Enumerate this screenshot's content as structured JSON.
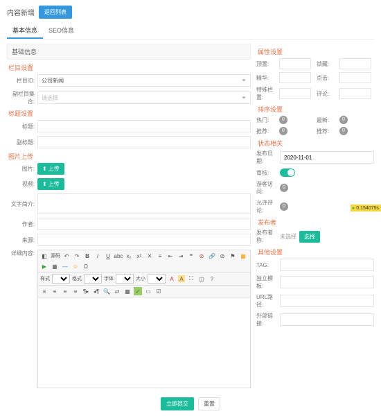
{
  "header": {
    "title": "内容新增",
    "back_btn": "返回列表"
  },
  "tabs": [
    "基本信息",
    "SEO信息"
  ],
  "panel_left": "基础信息",
  "sections": {
    "col": "栏目设置",
    "title": "标题设置",
    "img": "图片上传",
    "prop": "属性设置",
    "sort": "排序设置",
    "status": "状态相关",
    "author": "发布者",
    "other": "其他设置"
  },
  "left": {
    "col_id": "栏目ID:",
    "col_val": "公司新闻",
    "sub_col": "副栏目集合:",
    "sub_ph": "请选择",
    "title_lbl": "标题:",
    "subtitle_lbl": "副标题:",
    "img_lbl": "图片:",
    "vid_lbl": "视频:",
    "upload": "上传",
    "intro_lbl": "文字简介:",
    "author_lbl": "作者:",
    "source_lbl": "来源:",
    "content_lbl": "详细内容:"
  },
  "right": {
    "top": "顶置:",
    "hide": "锁藏:",
    "hot": "精华:",
    "hit": "点击:",
    "ex1": "特殊栏置:",
    "ex2": "评论:",
    "hot2": "热门:",
    "new": "最新:",
    "rec": "推荐:",
    "slide": "推荐:",
    "pub_date": "发布日期:",
    "pub_val": "2020-11-01",
    "audit": "审核:",
    "hits_lbl": "游客访问:",
    "hits_val": "0",
    "cmt_lbl": "允许评论:",
    "cmt_val": "0",
    "pub_lbl": "发布者称:",
    "pub_txt": "未选择",
    "sel_btn": "选择",
    "tag": "TAG:",
    "tpl": "独立模板:",
    "url": "URL路径:",
    "ext": "外部链接:"
  },
  "editor": {
    "row2_labels": [
      "样式",
      "格式",
      "字体",
      "大小"
    ]
  },
  "footer": {
    "submit": "立即提交",
    "reset": "重置"
  },
  "perf": "0.154075s"
}
